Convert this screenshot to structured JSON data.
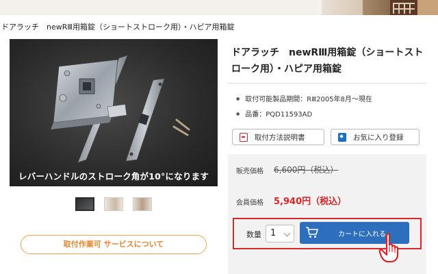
{
  "breadcrumb": "ドアラッチ　newRⅢ用箱錠（ショートストローク用）・ハピア用箱錠",
  "product": {
    "title": "ドアラッチ　newRⅢ用箱錠（ショートストローク用）・ハピア用箱錠",
    "image_caption": "レバーハンドルのストローク角が10°になります",
    "specs": [
      "取付可能製品期間：RⅢ2005年8月〜現在",
      "品番：PQD11593AD"
    ]
  },
  "buttons": {
    "manual": "取付方法説明書",
    "favorite": "お気に入り登録",
    "service": "取付作業可 サービスについて",
    "add_to_cart": "カートに入れる"
  },
  "price": {
    "regular_label": "販売価格",
    "regular_value": "6,600円（税込）",
    "member_label": "会員価格",
    "member_value": "5,940円（税込）"
  },
  "cart": {
    "qty_label": "数量",
    "qty_value": "1"
  },
  "icons": {
    "manual": "document-icon",
    "favorite": "bookmark-icon",
    "cart": "cart-icon",
    "pointer": "hand-pointer-icon"
  },
  "colors": {
    "accent_red": "#d8262a",
    "button_blue": "#2e6fbd",
    "service_orange": "#e8872a"
  }
}
